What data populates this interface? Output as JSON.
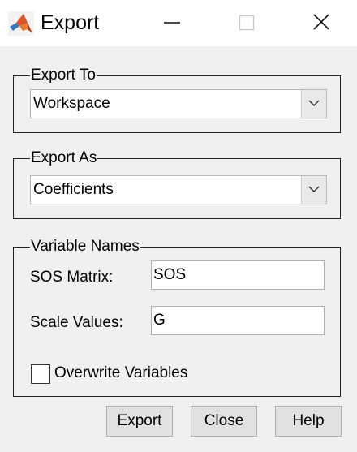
{
  "window": {
    "title": "Export",
    "app_icon": "matlab-logo-icon",
    "controls": [
      "minimize-icon",
      "maximize-icon",
      "close-icon"
    ]
  },
  "export_to": {
    "legend": "Export To",
    "selected": "Workspace"
  },
  "export_as": {
    "legend": "Export As",
    "selected": "Coefficients"
  },
  "variable_names": {
    "legend": "Variable Names",
    "sos_label": "SOS Matrix:",
    "sos_value": "SOS",
    "scale_label": "Scale Values:",
    "scale_value": "G",
    "overwrite_label": "Overwrite Variables",
    "overwrite_checked": false
  },
  "buttons": {
    "export": "Export",
    "close": "Close",
    "help": "Help"
  }
}
